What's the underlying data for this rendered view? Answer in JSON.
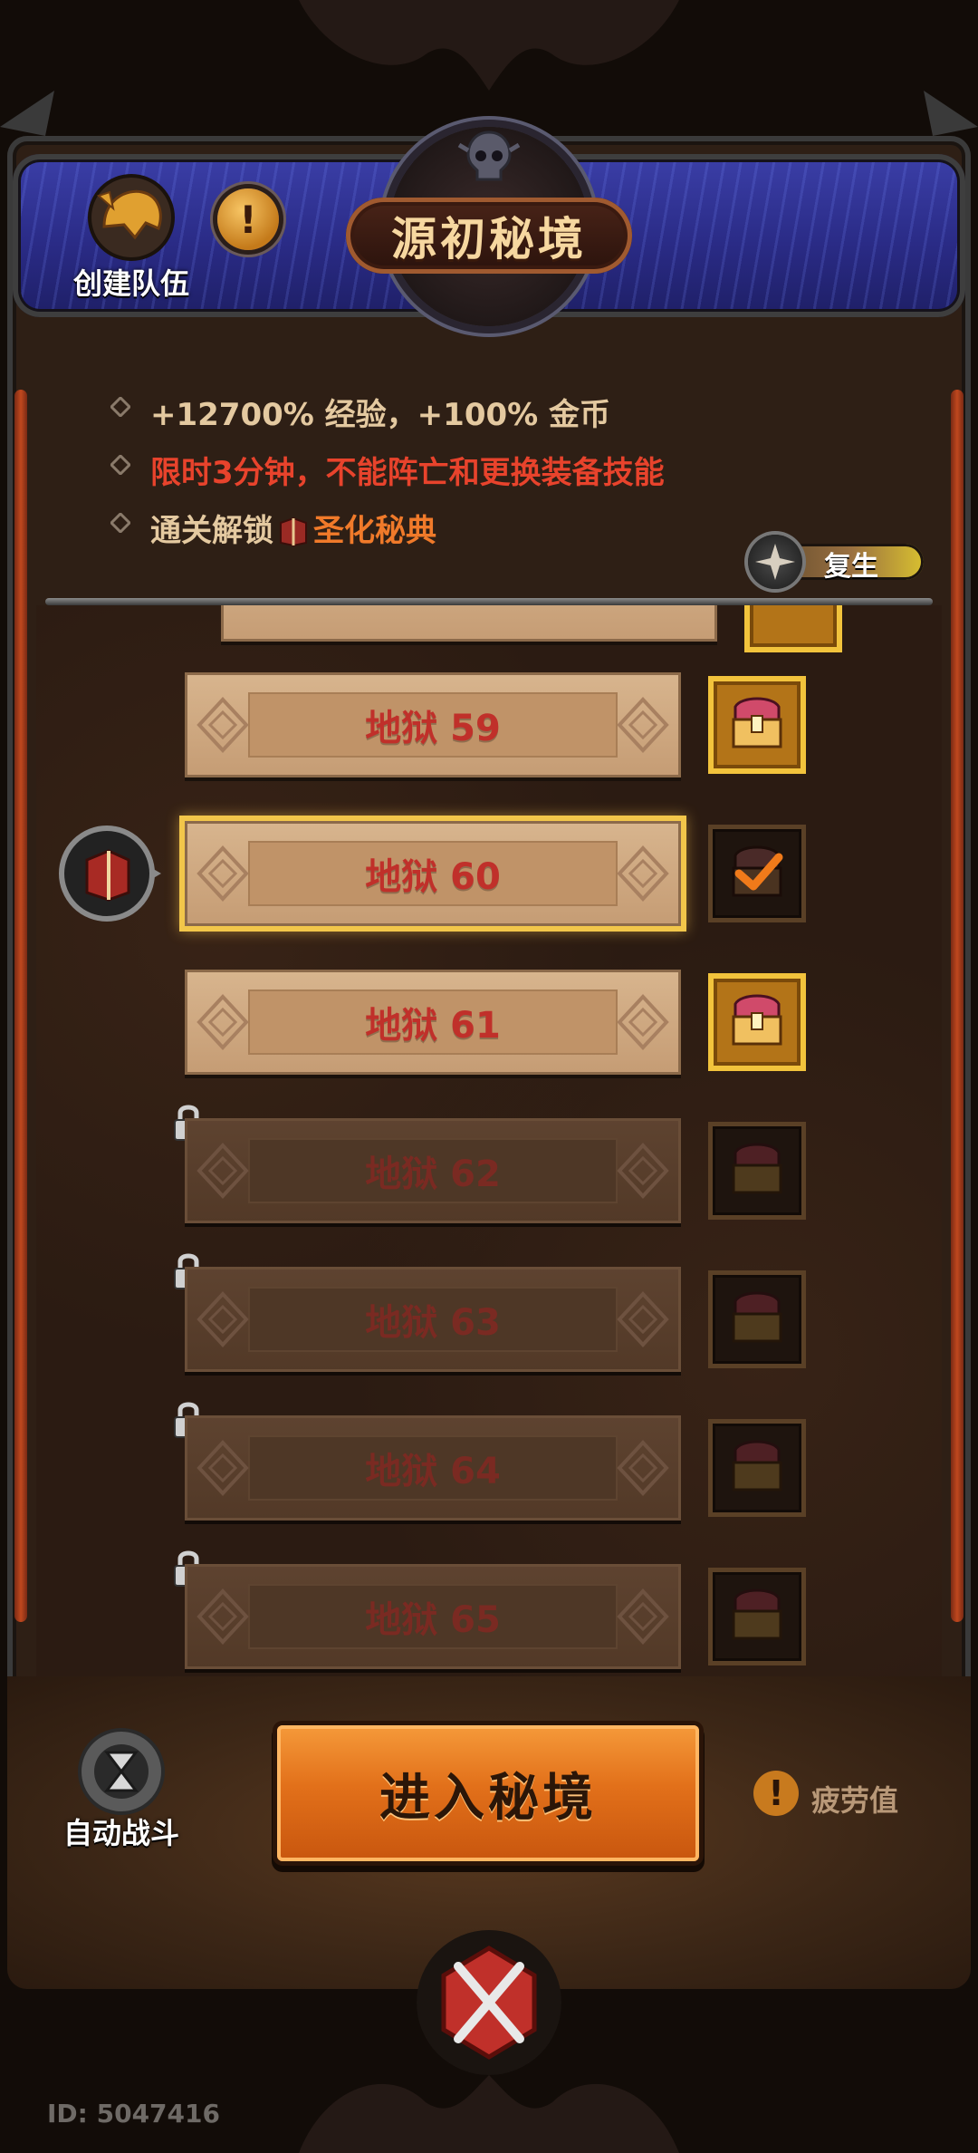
{
  "header": {
    "title": "源初秘境",
    "create_team_label": "创建队伍"
  },
  "rules": {
    "line1": "+12700% 经验，+100% 金币",
    "line2": "限时3分钟，不能阵亡和更换装备技能",
    "line3_prefix": "通关解锁",
    "line3_reward": "圣化秘典"
  },
  "revive_label": "复生",
  "levels": [
    {
      "label": "地狱 59",
      "state": "unlocked",
      "chest": "available"
    },
    {
      "label": "地狱 60",
      "state": "selected",
      "chest": "claimed"
    },
    {
      "label": "地狱 61",
      "state": "unlocked",
      "chest": "available"
    },
    {
      "label": "地狱 62",
      "state": "locked",
      "chest": "locked"
    },
    {
      "label": "地狱 63",
      "state": "locked",
      "chest": "locked"
    },
    {
      "label": "地狱 64",
      "state": "locked",
      "chest": "locked"
    },
    {
      "label": "地狱 65",
      "state": "locked",
      "chest": "locked"
    }
  ],
  "bottom": {
    "auto_battle_label": "自动战斗",
    "enter_label": "进入秘境",
    "fatigue_label": "疲劳值"
  },
  "player_id": "ID: 5047416",
  "colors": {
    "accent_orange": "#e2701a",
    "level_text_red": "#c0302a",
    "warning_red": "#e8432c",
    "gold_frame": "#f2c33c"
  }
}
